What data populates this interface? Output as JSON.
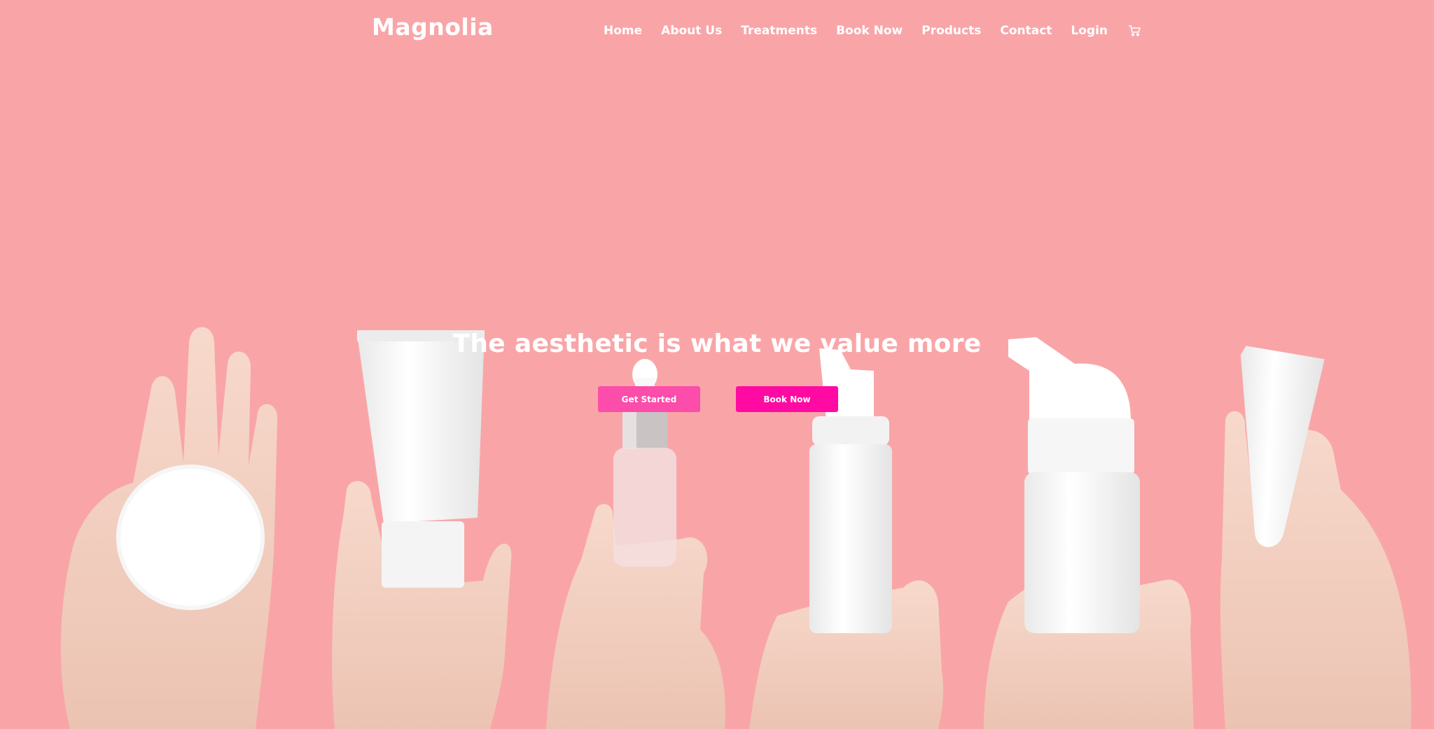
{
  "brand": {
    "name": "Magnolia"
  },
  "nav": {
    "items": [
      {
        "label": "Home"
      },
      {
        "label": "About Us"
      },
      {
        "label": "Treatments"
      },
      {
        "label": "Book Now"
      },
      {
        "label": "Products"
      },
      {
        "label": "Contact"
      },
      {
        "label": "Login"
      }
    ],
    "cart_icon": "cart-icon"
  },
  "hero": {
    "title": "The aesthetic is what we value more",
    "primary_button": "Get Started",
    "secondary_button": "Book Now"
  },
  "colors": {
    "background": "#f9a5a8",
    "button_primary": "#fb4da9",
    "button_secondary": "#ff0aa3",
    "text": "#ffffff"
  }
}
